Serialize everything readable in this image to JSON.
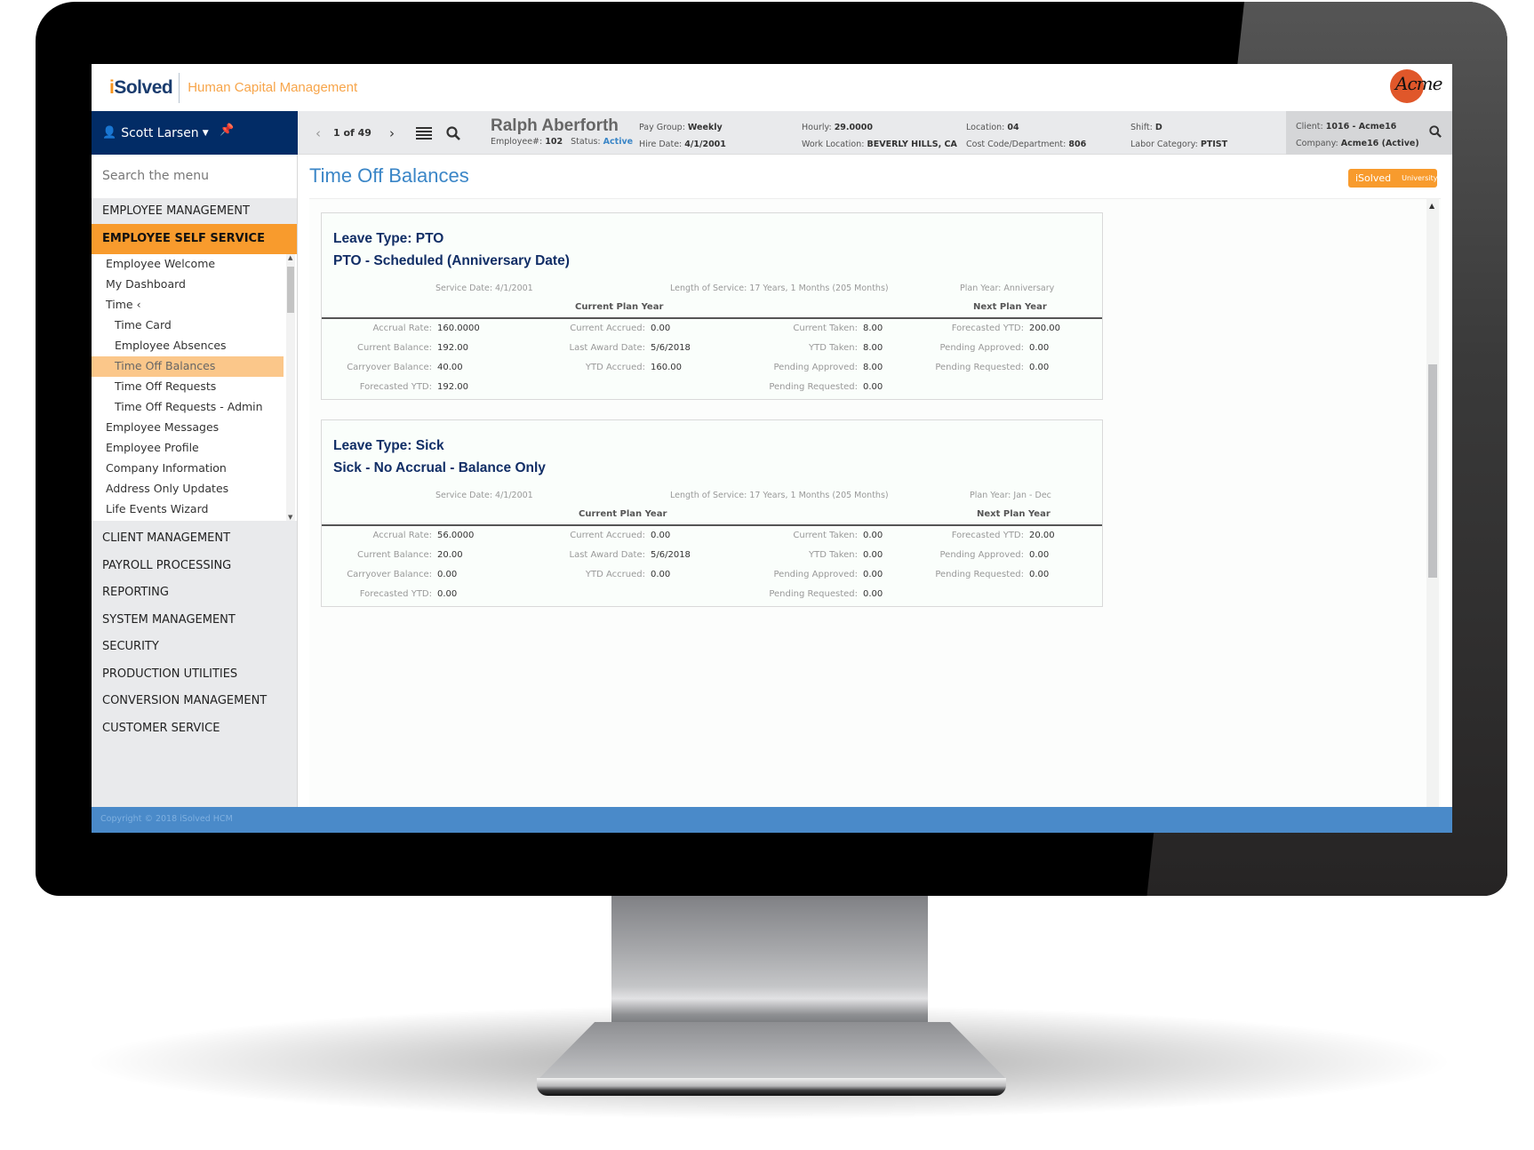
{
  "header": {
    "brand_i": "i",
    "brand_rest": "Solved",
    "app_title": "Human Capital Management",
    "client_logo": "Acme"
  },
  "user": {
    "name": "Scott Larsen"
  },
  "pager": {
    "count": "1 of 49"
  },
  "employee": {
    "name": "Ralph Aberforth",
    "number_label": "Employee#:",
    "number": "102",
    "status_label": "Status:",
    "status": "Active",
    "pay_group_label": "Pay Group:",
    "pay_group": "Weekly",
    "hire_date_label": "Hire Date:",
    "hire_date": "4/1/2001",
    "hourly_label": "Hourly:",
    "hourly": "29.0000",
    "work_location_label": "Work Location:",
    "work_location": "BEVERLY HILLS, CA",
    "location_label": "Location:",
    "location": "04",
    "cost_code_label": "Cost Code/Department:",
    "cost_code": "806",
    "shift_label": "Shift:",
    "shift": "D",
    "labor_category_label": "Labor Category:",
    "labor_category": "PTIST"
  },
  "client": {
    "client_label": "Client:",
    "client": "1016 - Acme16",
    "company_label": "Company:",
    "company": "Acme16 (Active)"
  },
  "sidebar": {
    "search_placeholder": "Search the menu",
    "top_sections": [
      "EMPLOYEE MANAGEMENT",
      "EMPLOYEE SELF SERVICE"
    ],
    "sub_items": [
      {
        "label": "Employee Welcome",
        "level": 1
      },
      {
        "label": "My Dashboard",
        "level": 1
      },
      {
        "label": "Time  ‹",
        "level": 1
      },
      {
        "label": "Time Card",
        "level": 2
      },
      {
        "label": "Employee Absences",
        "level": 2
      },
      {
        "label": "Time Off Balances",
        "level": 2,
        "selected": true
      },
      {
        "label": "Time Off Requests",
        "level": 2
      },
      {
        "label": "Time Off Requests - Admin",
        "level": 2
      },
      {
        "label": "Employee Messages",
        "level": 1
      },
      {
        "label": "Employee Profile",
        "level": 1
      },
      {
        "label": "Company Information",
        "level": 1
      },
      {
        "label": "Address Only Updates",
        "level": 1
      },
      {
        "label": "Life Events Wizard",
        "level": 1
      }
    ],
    "lower_sections": [
      "CLIENT MANAGEMENT",
      "PAYROLL PROCESSING",
      "REPORTING",
      "SYSTEM MANAGEMENT",
      "SECURITY",
      "PRODUCTION UTILITIES",
      "CONVERSION MANAGEMENT",
      "CUSTOMER SERVICE"
    ]
  },
  "main": {
    "page_title": "Time Off Balances",
    "badge_brand": "iSolved",
    "badge_sub": "University",
    "current_plan_year": "Current Plan Year",
    "next_plan_year": "Next Plan Year",
    "cards": [
      {
        "leave_type": "Leave Type: PTO",
        "plan_name": "PTO - Scheduled (Anniversary Date)",
        "service_date": "Service Date: 4/1/2001",
        "length_of_service": "Length of Service: 17 Years, 1 Months (205 Months)",
        "plan_year": "Plan Year: Anniversary",
        "col1": [
          {
            "label": "Accrual Rate:",
            "value": "160.0000"
          },
          {
            "label": "Current Balance:",
            "value": "192.00"
          },
          {
            "label": "Carryover Balance:",
            "value": "40.00"
          },
          {
            "label": "Forecasted YTD:",
            "value": "192.00"
          }
        ],
        "col2": [
          {
            "label": "Current Accrued:",
            "value": "0.00"
          },
          {
            "label": "Last Award Date:",
            "value": "5/6/2018"
          },
          {
            "label": "YTD Accrued:",
            "value": "160.00"
          }
        ],
        "col3": [
          {
            "label": "Current Taken:",
            "value": "8.00"
          },
          {
            "label": "YTD Taken:",
            "value": "8.00"
          },
          {
            "label": "Pending Approved:",
            "value": "8.00"
          },
          {
            "label": "Pending Requested:",
            "value": "0.00"
          }
        ],
        "col4": [
          {
            "label": "Forecasted YTD:",
            "value": "200.00"
          },
          {
            "label": "Pending Approved:",
            "value": "0.00"
          },
          {
            "label": "Pending Requested:",
            "value": "0.00"
          }
        ]
      },
      {
        "leave_type": "Leave Type: Sick",
        "plan_name": "Sick - No Accrual - Balance Only",
        "service_date": "Service Date: 4/1/2001",
        "length_of_service": "Length of Service: 17 Years, 1 Months (205 Months)",
        "plan_year": "Plan Year: Jan - Dec",
        "col1": [
          {
            "label": "Accrual Rate:",
            "value": "56.0000"
          },
          {
            "label": "Current Balance:",
            "value": "20.00"
          },
          {
            "label": "Carryover Balance:",
            "value": "0.00"
          },
          {
            "label": "Forecasted YTD:",
            "value": "0.00"
          }
        ],
        "col2": [
          {
            "label": "Current Accrued:",
            "value": "0.00"
          },
          {
            "label": "Last Award Date:",
            "value": "5/6/2018"
          },
          {
            "label": "YTD Accrued:",
            "value": "0.00"
          }
        ],
        "col3": [
          {
            "label": "Current Taken:",
            "value": "0.00"
          },
          {
            "label": "YTD Taken:",
            "value": "0.00"
          },
          {
            "label": "Pending Approved:",
            "value": "0.00"
          },
          {
            "label": "Pending Requested:",
            "value": "0.00"
          }
        ],
        "col4": [
          {
            "label": "Forecasted YTD:",
            "value": "20.00"
          },
          {
            "label": "Pending Approved:",
            "value": "0.00"
          },
          {
            "label": "Pending Requested:",
            "value": "0.00"
          }
        ]
      }
    ]
  },
  "footer": {
    "copyright": "Copyright © 2018 iSolved HCM"
  },
  "colors": {
    "navy": "#022c66",
    "orange": "#f89b2d",
    "blue_accent": "#3b86c7",
    "footer_blue": "#4a8ac9"
  }
}
